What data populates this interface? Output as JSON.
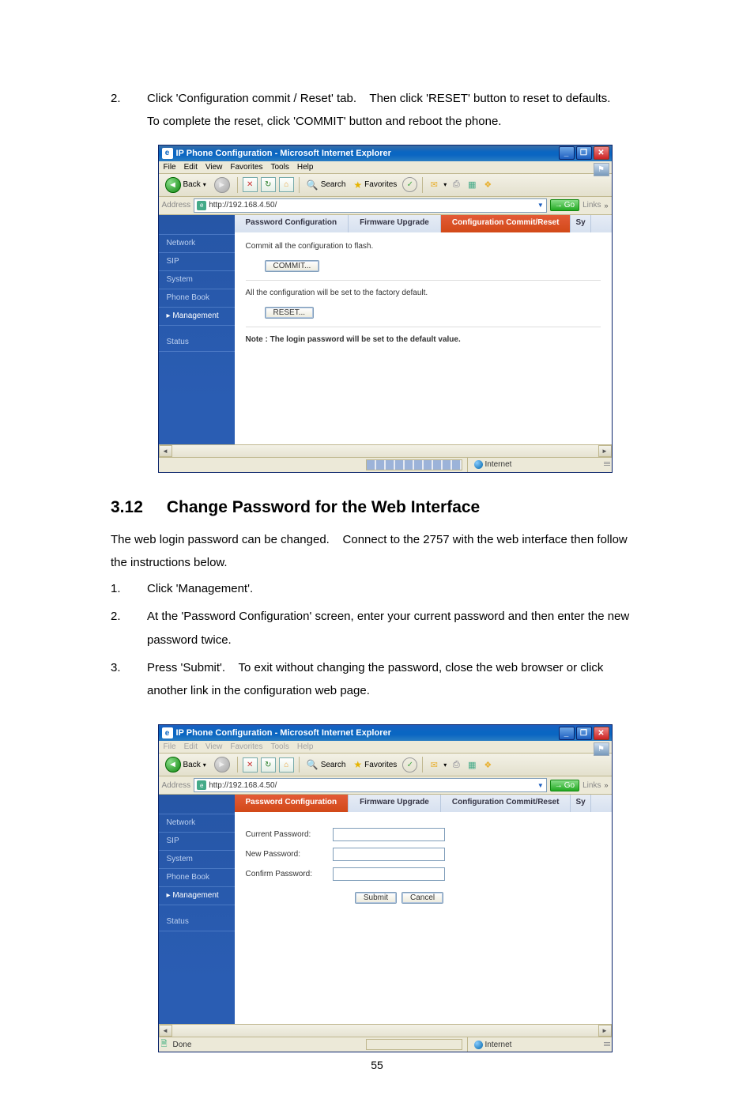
{
  "step2": {
    "num": "2.",
    "text1_a": "Click 'Configuration commit / Reset' tab.",
    "text1_b": "Then click 'RESET' button to reset to defaults.",
    "text2": "To complete the reset, click 'COMMIT' button and reboot the phone."
  },
  "section": {
    "num": "3.12",
    "title": "Change Password for the Web Interface"
  },
  "intro": {
    "text_a": "The web login password can be changed.",
    "text_b": "Connect to the 2757 with the web interface then follow",
    "text2": "the instructions below."
  },
  "list": {
    "i1_num": "1.",
    "i1_text": "Click 'Management'.",
    "i2_num": "2.",
    "i2_text1": "At the 'Password Configuration' screen, enter your current password and then enter the new",
    "i2_text2": "password twice.",
    "i3_num": "3.",
    "i3_text1_a": "Press 'Submit'.",
    "i3_text1_b": "To exit without changing the password, close the web browser or click",
    "i3_text2": "another link in the configuration web page."
  },
  "ie": {
    "title": "IP Phone Configuration - Microsoft Internet Explorer",
    "menus": {
      "file": "File",
      "edit": "Edit",
      "view": "View",
      "favorites": "Favorites",
      "tools": "Tools",
      "help": "Help"
    },
    "toolbar": {
      "back": "Back",
      "search": "Search",
      "favorites": "Favorites"
    },
    "address_label": "Address",
    "url": "http://192.168.4.50/",
    "go": "Go",
    "links": "Links",
    "zone": "Internet",
    "done": "Done"
  },
  "sidebar": {
    "network": "Network",
    "sip": "SIP",
    "system": "System",
    "phonebook": "Phone Book",
    "management": "Management",
    "status": "Status"
  },
  "tabs": {
    "password": "Password Configuration",
    "firmware": "Firmware Upgrade",
    "commitreset": "Configuration Commit/Reset",
    "sy": "Sy"
  },
  "screenshot1": {
    "commit_text": "Commit all the configuration to flash.",
    "commit_btn": "COMMIT...",
    "reset_text": "All the configuration will be set to the factory default.",
    "reset_btn": "RESET...",
    "note": "Note : The login password will be set to the default value."
  },
  "screenshot2": {
    "current": "Current Password:",
    "new": "New Password:",
    "confirm": "Confirm Password:",
    "submit": "Submit",
    "cancel": "Cancel"
  },
  "page_number": "55"
}
